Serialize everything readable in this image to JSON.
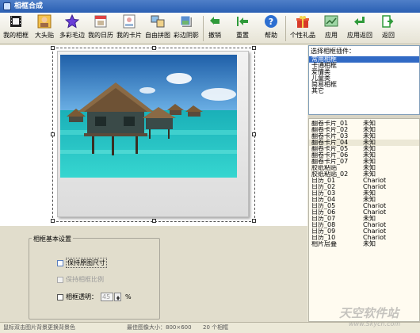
{
  "window": {
    "title": "相框合成"
  },
  "toolbar": {
    "buttons": [
      {
        "label": "我的相框",
        "icon": "film-icon"
      },
      {
        "label": "大头贴",
        "icon": "portrait-icon"
      },
      {
        "label": "多彩毛边",
        "icon": "star-icon"
      },
      {
        "label": "我的日历",
        "icon": "calendar-icon"
      },
      {
        "label": "我的卡片",
        "icon": "card-icon"
      },
      {
        "label": "自由拼图",
        "icon": "collage-icon"
      },
      {
        "label": "彩边阴影",
        "icon": "shadow-icon"
      },
      {
        "label": "撤销",
        "icon": "undo-icon"
      },
      {
        "label": "重置",
        "icon": "reset-icon"
      },
      {
        "label": "帮助",
        "icon": "help-icon"
      },
      {
        "label": "个性礼品",
        "icon": "gift-icon"
      },
      {
        "label": "应用",
        "icon": "apply-icon"
      },
      {
        "label": "应用返回",
        "icon": "apply-return-icon"
      },
      {
        "label": "返回",
        "icon": "exit-icon"
      }
    ]
  },
  "colors": {
    "accent_selected": "#316ac5",
    "titlebar": "#2a5fb3",
    "panel_bg": "#ece9d8"
  },
  "frame_list": {
    "header": "选择相框插件：",
    "items": [
      "常用相框",
      "卡通相框",
      "爱情类",
      "儿童类",
      "简易相框",
      "其它"
    ],
    "selected_index": 0
  },
  "template_list": {
    "rows": [
      {
        "name": "翻卷卡片_01",
        "author": "未知"
      },
      {
        "name": "翻卷卡片_02",
        "author": "未知"
      },
      {
        "name": "翻卷卡片_03",
        "author": "未知"
      },
      {
        "name": "翻卷卡片_04",
        "author": "未知"
      },
      {
        "name": "翻卷卡片_05",
        "author": "未知"
      },
      {
        "name": "翻卷卡片_06",
        "author": "未知"
      },
      {
        "name": "翻卷卡片_07",
        "author": "未知"
      },
      {
        "name": "胶纸粘贴",
        "author": "未知"
      },
      {
        "name": "胶纸粘贴_02",
        "author": "未知"
      },
      {
        "name": "日历_01",
        "author": "Chariot"
      },
      {
        "name": "日历_02",
        "author": "Chariot"
      },
      {
        "name": "日历_03",
        "author": "未知"
      },
      {
        "name": "日历_04",
        "author": "未知"
      },
      {
        "name": "日历_05",
        "author": "Chariot"
      },
      {
        "name": "日历_06",
        "author": "Chariot"
      },
      {
        "name": "日历_07",
        "author": "未知"
      },
      {
        "name": "日历_08",
        "author": "Chariot"
      },
      {
        "name": "日历_09",
        "author": "Chariot"
      },
      {
        "name": "日历_10",
        "author": "Chariot"
      },
      {
        "name": "相片层叠",
        "author": "未知"
      }
    ],
    "highlighted_index": 3
  },
  "settings": {
    "group_title": "相框基本设置",
    "keep_size_label": "保持原图尺寸",
    "keep_ratio_label": "保持相框比例",
    "opacity_label": "相框透明：",
    "opacity_value": "45",
    "opacity_unit": "%"
  },
  "status": {
    "hint": "鼠标双击图片背景更换背景色",
    "image_size": "最佳图像大小：800×600",
    "count": "20 个相框"
  },
  "watermark": {
    "big": "天空软件站",
    "small": "www.Skycn.com"
  }
}
